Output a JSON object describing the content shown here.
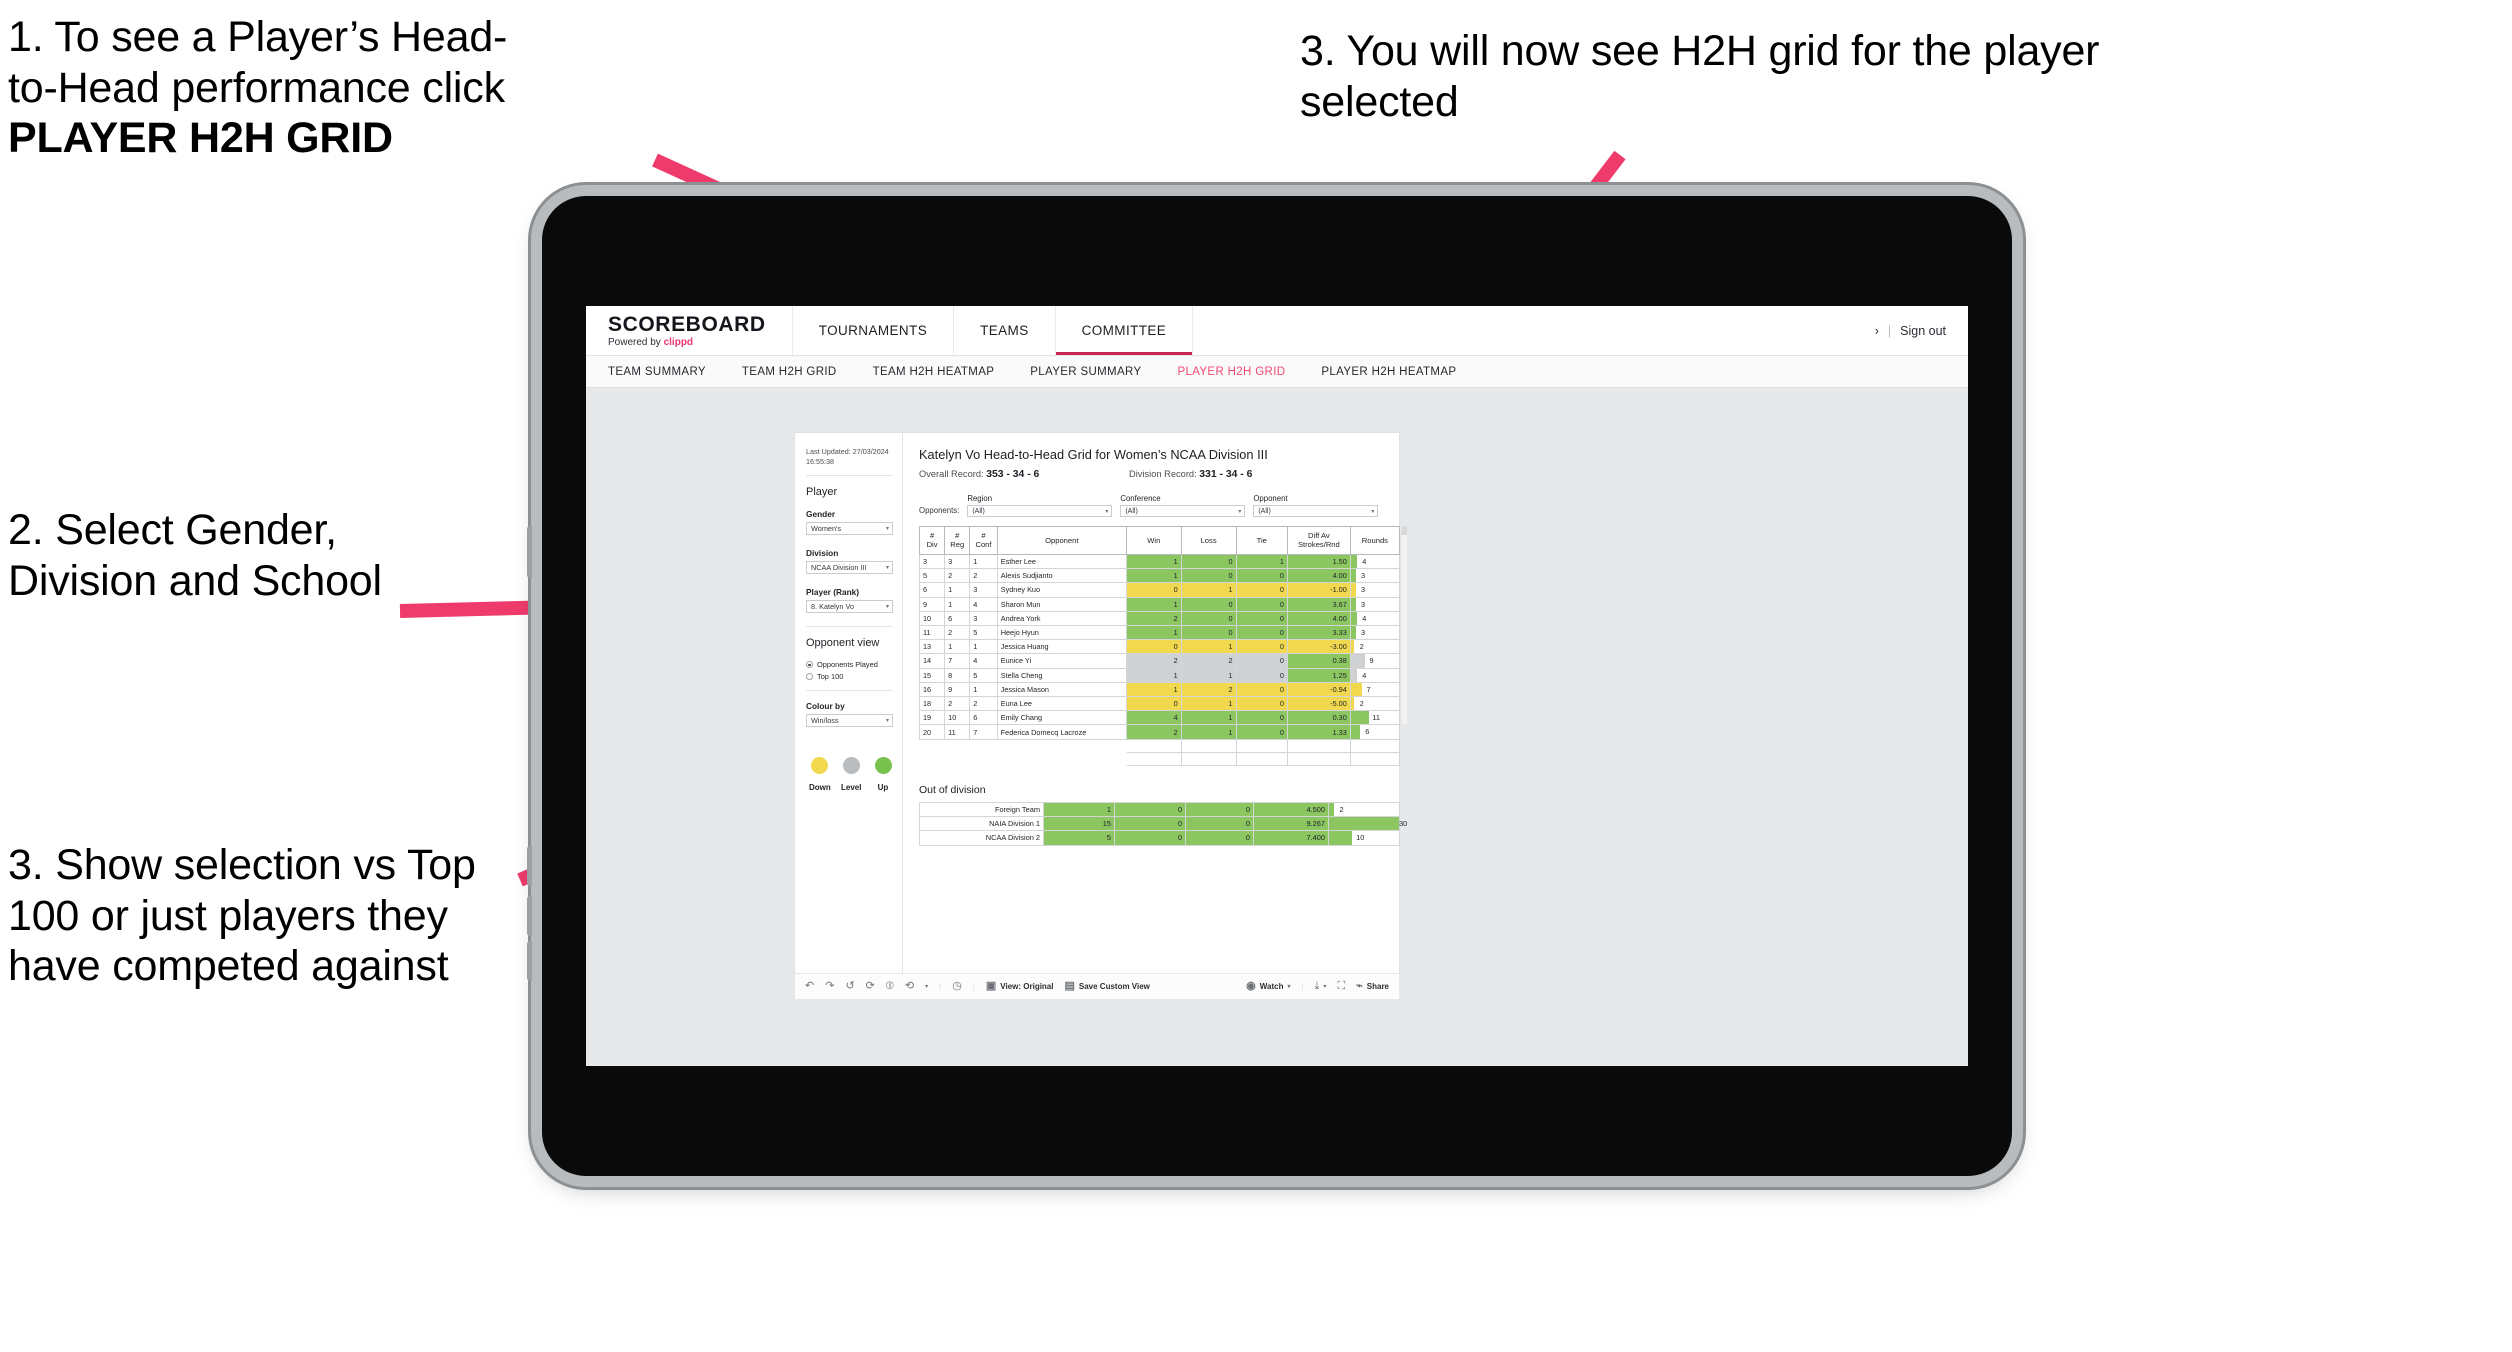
{
  "annotations": [
    {
      "id": "anno-1",
      "line1": "1. To see a Player’s Head-",
      "line2": "to-Head performance click",
      "bold": "PLAYER H2H GRID"
    },
    {
      "id": "anno-2",
      "text": "2. Select Gender, Division and School"
    },
    {
      "id": "anno-3",
      "text": "3. Show selection vs Top 100 or just players they have competed against"
    },
    {
      "id": "anno-4",
      "text": "3. You will now see H2H grid for the player selected"
    }
  ],
  "brand": {
    "title": "SCOREBOARD",
    "powered_prefix": "Powered by ",
    "powered_brand": "clippd"
  },
  "topnav": [
    {
      "label": "TOURNAMENTS",
      "active": false
    },
    {
      "label": "TEAMS",
      "active": false
    },
    {
      "label": "COMMITTEE",
      "active": true
    }
  ],
  "header_right": {
    "chevron": "›",
    "separator": "|",
    "sign_out": "Sign out"
  },
  "subnav": [
    {
      "label": "TEAM SUMMARY",
      "active": false
    },
    {
      "label": "TEAM H2H GRID",
      "active": false
    },
    {
      "label": "TEAM H2H HEATMAP",
      "active": false
    },
    {
      "label": "PLAYER SUMMARY",
      "active": false
    },
    {
      "label": "PLAYER H2H GRID",
      "active": true
    },
    {
      "label": "PLAYER H2H HEATMAP",
      "active": false
    }
  ],
  "sidebar": {
    "last_updated": "Last Updated: 27/03/2024 16:55:38",
    "player_group_title": "Player",
    "filters": [
      {
        "label": "Gender",
        "value": "Women's"
      },
      {
        "label": "Division",
        "value": "NCAA Division III"
      },
      {
        "label": "Player (Rank)",
        "value": "8. Katelyn Vo"
      }
    ],
    "opponent_view": {
      "title": "Opponent view",
      "options": [
        {
          "label": "Opponents Played",
          "selected": true
        },
        {
          "label": "Top 100",
          "selected": false
        }
      ]
    },
    "colour_by": {
      "label": "Colour by",
      "value": "Win/loss"
    },
    "legend": [
      {
        "label": "Down",
        "color": "#f1d84e"
      },
      {
        "label": "Level",
        "color": "#b9bdbf"
      },
      {
        "label": "Up",
        "color": "#79c14f"
      }
    ]
  },
  "main": {
    "title": "Katelyn Vo Head-to-Head Grid for Women’s NCAA Division III",
    "overall_record_label": "Overall Record:",
    "overall_record_value": "353 -  34 - 6",
    "division_record_label": "Division Record:",
    "division_record_value": "331 -  34 - 6",
    "opponents_label": "Opponents:",
    "opponent_filters": [
      {
        "label": "Region",
        "value": "(All)"
      },
      {
        "label": "Conference",
        "value": "(All)"
      },
      {
        "label": "Opponent",
        "value": "(All)"
      }
    ],
    "table_headers": [
      {
        "top": "#",
        "bottom": "Div"
      },
      {
        "top": "#",
        "bottom": "Reg"
      },
      {
        "top": "#",
        "bottom": "Conf"
      },
      {
        "top": "Opponent",
        "bottom": ""
      },
      {
        "top": "Win",
        "bottom": ""
      },
      {
        "top": "Loss",
        "bottom": ""
      },
      {
        "top": "Tie",
        "bottom": ""
      },
      {
        "top": "Diff Av",
        "bottom": "Strokes/Rnd"
      },
      {
        "top": "Rounds",
        "bottom": ""
      }
    ],
    "out_of_division_title": "Out of division"
  },
  "chart_data": {
    "type": "table",
    "title": "Katelyn Vo Head-to-Head Grid for Women’s NCAA Division III",
    "columns": [
      "# Div",
      "# Reg",
      "# Conf",
      "Opponent",
      "Win",
      "Loss",
      "Tie",
      "Diff Av Strokes/Rnd",
      "Rounds"
    ],
    "colour_by": "Win/loss",
    "colour_scale": {
      "down": "#f1d84e",
      "level": "#cfd1d3",
      "up": "#8cc661"
    },
    "rounds_max": 30,
    "rows": [
      {
        "div": "3",
        "reg": "3",
        "conf": "1",
        "opponent": "Esther Lee",
        "win": "1",
        "loss": "0",
        "tie": "1",
        "diff": "1.50",
        "rounds": "4",
        "state": "up"
      },
      {
        "div": "5",
        "reg": "2",
        "conf": "2",
        "opponent": "Alexis Sudjianto",
        "win": "1",
        "loss": "0",
        "tie": "0",
        "diff": "4.00",
        "rounds": "3",
        "state": "up"
      },
      {
        "div": "6",
        "reg": "1",
        "conf": "3",
        "opponent": "Sydney Kuo",
        "win": "0",
        "loss": "1",
        "tie": "0",
        "diff": "-1.00",
        "rounds": "3",
        "state": "down"
      },
      {
        "div": "9",
        "reg": "1",
        "conf": "4",
        "opponent": "Sharon Mun",
        "win": "1",
        "loss": "0",
        "tie": "0",
        "diff": "3.67",
        "rounds": "3",
        "state": "up"
      },
      {
        "div": "10",
        "reg": "6",
        "conf": "3",
        "opponent": "Andrea York",
        "win": "2",
        "loss": "0",
        "tie": "0",
        "diff": "4.00",
        "rounds": "4",
        "state": "up"
      },
      {
        "div": "11",
        "reg": "2",
        "conf": "5",
        "opponent": "Heejo Hyun",
        "win": "1",
        "loss": "0",
        "tie": "0",
        "diff": "3.33",
        "rounds": "3",
        "state": "up"
      },
      {
        "div": "13",
        "reg": "1",
        "conf": "1",
        "opponent": "Jessica Huang",
        "win": "0",
        "loss": "1",
        "tie": "0",
        "diff": "-3.00",
        "rounds": "2",
        "state": "down"
      },
      {
        "div": "14",
        "reg": "7",
        "conf": "4",
        "opponent": "Eunice Yi",
        "win": "2",
        "loss": "2",
        "tie": "0",
        "diff": "0.38",
        "rounds": "9",
        "state": "level",
        "diff_state": "up"
      },
      {
        "div": "15",
        "reg": "8",
        "conf": "5",
        "opponent": "Stella Cheng",
        "win": "1",
        "loss": "1",
        "tie": "0",
        "diff": "1.25",
        "rounds": "4",
        "state": "level",
        "diff_state": "up"
      },
      {
        "div": "16",
        "reg": "9",
        "conf": "1",
        "opponent": "Jessica Mason",
        "win": "1",
        "loss": "2",
        "tie": "0",
        "diff": "-0.94",
        "rounds": "7",
        "state": "down"
      },
      {
        "div": "18",
        "reg": "2",
        "conf": "2",
        "opponent": "Euna Lee",
        "win": "0",
        "loss": "1",
        "tie": "0",
        "diff": "-5.00",
        "rounds": "2",
        "state": "down"
      },
      {
        "div": "19",
        "reg": "10",
        "conf": "6",
        "opponent": "Emily Chang",
        "win": "4",
        "loss": "1",
        "tie": "0",
        "diff": "0.30",
        "rounds": "11",
        "state": "up"
      },
      {
        "div": "20",
        "reg": "11",
        "conf": "7",
        "opponent": "Federica Domecq Lacroze",
        "win": "2",
        "loss": "1",
        "tie": "0",
        "diff": "1.33",
        "rounds": "6",
        "state": "up"
      }
    ],
    "out_of_division": [
      {
        "name": "Foreign Team",
        "win": "1",
        "loss": "0",
        "tie": "0",
        "diff": "4.500",
        "rounds": "2",
        "state": "up"
      },
      {
        "name": "NAIA Division 1",
        "win": "15",
        "loss": "0",
        "tie": "0",
        "diff": "9.267",
        "rounds": "30",
        "state": "up"
      },
      {
        "name": "NCAA Division 2",
        "win": "5",
        "loss": "0",
        "tie": "0",
        "diff": "7.400",
        "rounds": "10",
        "state": "up"
      }
    ]
  },
  "toolbar": {
    "icons": [
      "undo-icon",
      "redo-icon",
      "revert-icon",
      "refresh-icon",
      "pause-icon",
      "loop-icon",
      "caret-icon"
    ],
    "clock_icon": "clock-icon",
    "view_label": "View: Original",
    "save_label": "Save Custom View",
    "watch_label": "Watch",
    "share_label": "Share"
  }
}
